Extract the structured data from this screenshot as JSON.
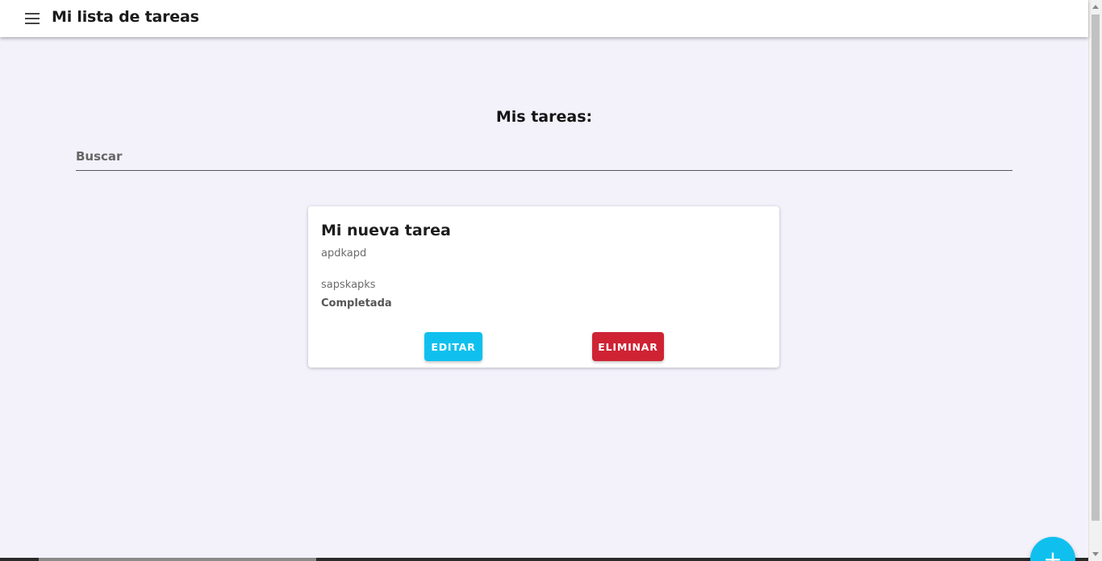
{
  "header": {
    "title": "Mi lista de tareas",
    "menu_icon": "hamburger-menu-icon"
  },
  "main": {
    "heading": "Mis tareas:",
    "search": {
      "placeholder": "Buscar",
      "value": ""
    },
    "tasks": [
      {
        "title": "Mi nueva tarea",
        "subtitle": "apdkapd",
        "description": "sapskapks",
        "status": "Completada",
        "edit_label": "EDITAR",
        "delete_label": "ELIMINAR"
      }
    ]
  },
  "fab": {
    "label": "+",
    "icon": "add-icon"
  },
  "colors": {
    "background": "#f3f2fb",
    "edit_button": "#0fc0ee",
    "delete_button": "#cf2334",
    "fab": "#0fc0ee"
  }
}
